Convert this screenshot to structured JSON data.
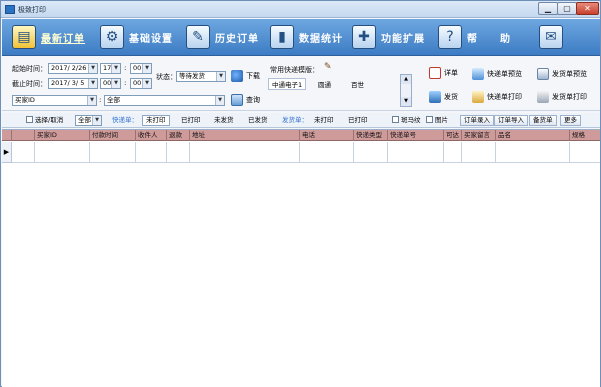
{
  "window": {
    "title": "极致打印"
  },
  "nav": {
    "items": [
      {
        "label": "最新订单",
        "icon": "new-order-icon",
        "glyph": "▤",
        "active": true
      },
      {
        "label": "基础设置",
        "icon": "settings-gear-icon",
        "glyph": "⚙",
        "active": false
      },
      {
        "label": "历史订单",
        "icon": "history-notes-icon",
        "glyph": "✎",
        "active": false
      },
      {
        "label": "数据统计",
        "icon": "bar-chart-icon",
        "glyph": "▮",
        "active": false
      },
      {
        "label": "功能扩展",
        "icon": "extension-icon",
        "glyph": "✚",
        "active": false
      },
      {
        "label": "帮　　助",
        "icon": "help-icon",
        "glyph": "?",
        "active": false
      }
    ]
  },
  "filter": {
    "start_label": "起始时间：",
    "start_date": "2017/ 2/26",
    "start_hour": "17",
    "start_min": "00",
    "end_label": "截止时间：",
    "end_date": "2017/ 3/ 5",
    "end_hour": "00",
    "end_min": "00",
    "status_label": "状态：",
    "status_value": "等待发货",
    "download_label": "下载",
    "buyer_id_value": "买家ID",
    "all_value": "全部",
    "query_label": "查询",
    "courier_label": "常用快递模版：",
    "templates": [
      "中通电子1",
      "圆通",
      "百世"
    ],
    "detail_label": "详单",
    "ship_label": "发货",
    "courier_preview": "快递单预览",
    "courier_print": "快递单打印",
    "dispatch_preview": "发货单预览",
    "dispatch_print": "发货单打印"
  },
  "toolbar": {
    "select_all": "选择/取消",
    "all_combo": "全部",
    "courier_sheet_label": "快递单：",
    "unprinted_1": "未打印",
    "printed_1": "已打印",
    "unshipped": "未发货",
    "shipped": "已发货",
    "dispatch_sheet_label": "发货单：",
    "unprinted_2": "未打印",
    "printed_2": "已打印",
    "zebra": "斑马纹",
    "picture": "图片",
    "order_entry": "订单录入",
    "order_import": "订单导入",
    "backup_sheet": "备货单",
    "more": "更多"
  },
  "grid": {
    "columns": [
      "买家ID",
      "付款时间",
      "收件人",
      "退款",
      "地址",
      "电话",
      "快递类型",
      "快递单号",
      "可达",
      "买家留言",
      "品名",
      "规格"
    ],
    "row_indicator": "▶"
  }
}
